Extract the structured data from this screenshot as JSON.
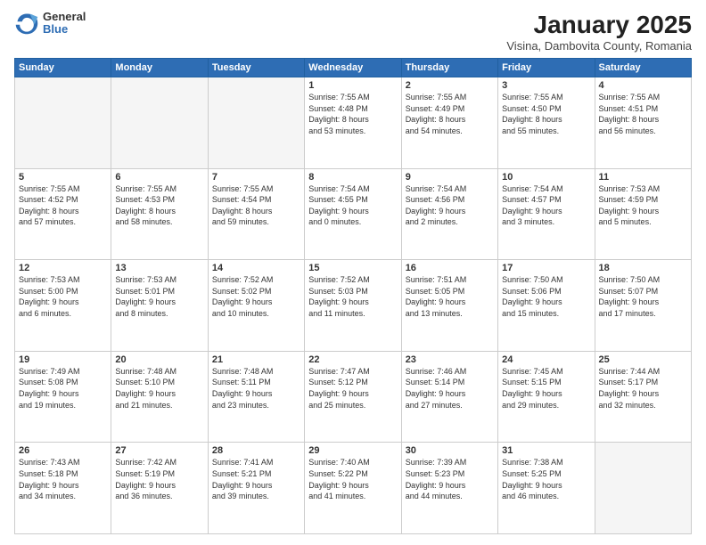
{
  "header": {
    "logo_general": "General",
    "logo_blue": "Blue",
    "month_title": "January 2025",
    "subtitle": "Visina, Dambovita County, Romania"
  },
  "weekdays": [
    "Sunday",
    "Monday",
    "Tuesday",
    "Wednesday",
    "Thursday",
    "Friday",
    "Saturday"
  ],
  "weeks": [
    [
      {
        "day": "",
        "info": ""
      },
      {
        "day": "",
        "info": ""
      },
      {
        "day": "",
        "info": ""
      },
      {
        "day": "1",
        "info": "Sunrise: 7:55 AM\nSunset: 4:48 PM\nDaylight: 8 hours\nand 53 minutes."
      },
      {
        "day": "2",
        "info": "Sunrise: 7:55 AM\nSunset: 4:49 PM\nDaylight: 8 hours\nand 54 minutes."
      },
      {
        "day": "3",
        "info": "Sunrise: 7:55 AM\nSunset: 4:50 PM\nDaylight: 8 hours\nand 55 minutes."
      },
      {
        "day": "4",
        "info": "Sunrise: 7:55 AM\nSunset: 4:51 PM\nDaylight: 8 hours\nand 56 minutes."
      }
    ],
    [
      {
        "day": "5",
        "info": "Sunrise: 7:55 AM\nSunset: 4:52 PM\nDaylight: 8 hours\nand 57 minutes."
      },
      {
        "day": "6",
        "info": "Sunrise: 7:55 AM\nSunset: 4:53 PM\nDaylight: 8 hours\nand 58 minutes."
      },
      {
        "day": "7",
        "info": "Sunrise: 7:55 AM\nSunset: 4:54 PM\nDaylight: 8 hours\nand 59 minutes."
      },
      {
        "day": "8",
        "info": "Sunrise: 7:54 AM\nSunset: 4:55 PM\nDaylight: 9 hours\nand 0 minutes."
      },
      {
        "day": "9",
        "info": "Sunrise: 7:54 AM\nSunset: 4:56 PM\nDaylight: 9 hours\nand 2 minutes."
      },
      {
        "day": "10",
        "info": "Sunrise: 7:54 AM\nSunset: 4:57 PM\nDaylight: 9 hours\nand 3 minutes."
      },
      {
        "day": "11",
        "info": "Sunrise: 7:53 AM\nSunset: 4:59 PM\nDaylight: 9 hours\nand 5 minutes."
      }
    ],
    [
      {
        "day": "12",
        "info": "Sunrise: 7:53 AM\nSunset: 5:00 PM\nDaylight: 9 hours\nand 6 minutes."
      },
      {
        "day": "13",
        "info": "Sunrise: 7:53 AM\nSunset: 5:01 PM\nDaylight: 9 hours\nand 8 minutes."
      },
      {
        "day": "14",
        "info": "Sunrise: 7:52 AM\nSunset: 5:02 PM\nDaylight: 9 hours\nand 10 minutes."
      },
      {
        "day": "15",
        "info": "Sunrise: 7:52 AM\nSunset: 5:03 PM\nDaylight: 9 hours\nand 11 minutes."
      },
      {
        "day": "16",
        "info": "Sunrise: 7:51 AM\nSunset: 5:05 PM\nDaylight: 9 hours\nand 13 minutes."
      },
      {
        "day": "17",
        "info": "Sunrise: 7:50 AM\nSunset: 5:06 PM\nDaylight: 9 hours\nand 15 minutes."
      },
      {
        "day": "18",
        "info": "Sunrise: 7:50 AM\nSunset: 5:07 PM\nDaylight: 9 hours\nand 17 minutes."
      }
    ],
    [
      {
        "day": "19",
        "info": "Sunrise: 7:49 AM\nSunset: 5:08 PM\nDaylight: 9 hours\nand 19 minutes."
      },
      {
        "day": "20",
        "info": "Sunrise: 7:48 AM\nSunset: 5:10 PM\nDaylight: 9 hours\nand 21 minutes."
      },
      {
        "day": "21",
        "info": "Sunrise: 7:48 AM\nSunset: 5:11 PM\nDaylight: 9 hours\nand 23 minutes."
      },
      {
        "day": "22",
        "info": "Sunrise: 7:47 AM\nSunset: 5:12 PM\nDaylight: 9 hours\nand 25 minutes."
      },
      {
        "day": "23",
        "info": "Sunrise: 7:46 AM\nSunset: 5:14 PM\nDaylight: 9 hours\nand 27 minutes."
      },
      {
        "day": "24",
        "info": "Sunrise: 7:45 AM\nSunset: 5:15 PM\nDaylight: 9 hours\nand 29 minutes."
      },
      {
        "day": "25",
        "info": "Sunrise: 7:44 AM\nSunset: 5:17 PM\nDaylight: 9 hours\nand 32 minutes."
      }
    ],
    [
      {
        "day": "26",
        "info": "Sunrise: 7:43 AM\nSunset: 5:18 PM\nDaylight: 9 hours\nand 34 minutes."
      },
      {
        "day": "27",
        "info": "Sunrise: 7:42 AM\nSunset: 5:19 PM\nDaylight: 9 hours\nand 36 minutes."
      },
      {
        "day": "28",
        "info": "Sunrise: 7:41 AM\nSunset: 5:21 PM\nDaylight: 9 hours\nand 39 minutes."
      },
      {
        "day": "29",
        "info": "Sunrise: 7:40 AM\nSunset: 5:22 PM\nDaylight: 9 hours\nand 41 minutes."
      },
      {
        "day": "30",
        "info": "Sunrise: 7:39 AM\nSunset: 5:23 PM\nDaylight: 9 hours\nand 44 minutes."
      },
      {
        "day": "31",
        "info": "Sunrise: 7:38 AM\nSunset: 5:25 PM\nDaylight: 9 hours\nand 46 minutes."
      },
      {
        "day": "",
        "info": ""
      }
    ]
  ]
}
